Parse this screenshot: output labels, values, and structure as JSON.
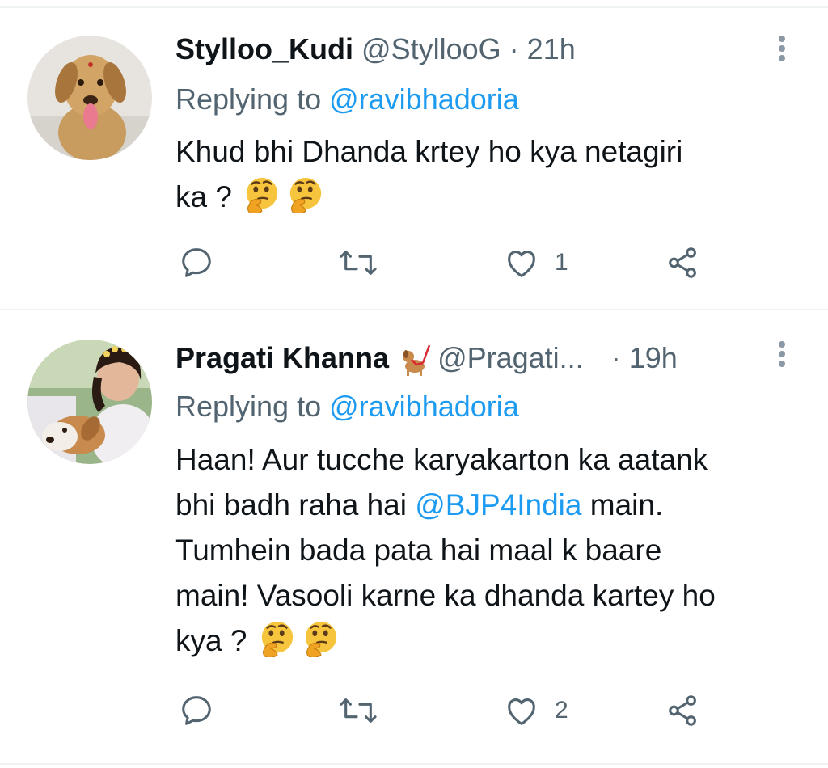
{
  "tweets": [
    {
      "display_name": "Stylloo_Kudi",
      "handle": "@StyllooG",
      "separator": "·",
      "time": "21h",
      "replying_prefix": "Replying to",
      "replying_handle": "@ravibhadoria",
      "text_parts": [
        "Khud bhi Dhanda krtey ho kya netagiri",
        "ka ?"
      ],
      "emojis": [
        "thinking-face",
        "thinking-face"
      ],
      "actions": {
        "reply_count": "",
        "retweet_count": "",
        "like_count": "1"
      }
    },
    {
      "display_name": "Pragati Khanna",
      "badge_icon": "dog-with-leash-emoji",
      "handle": "@Pragati...",
      "separator": "·",
      "time": "19h",
      "replying_prefix": "Replying to",
      "replying_handle": "@ravibhadoria",
      "text_parts": [
        "Haan! Aur tucche karyakarton ka aatank",
        "bhi badh raha hai",
        "@BJP4India",
        "main.",
        "Tumhein bada pata hai maal k baare",
        "main! Vasooli karne ka dhanda kartey ho",
        "kya ?"
      ],
      "emojis": [
        "thinking-face",
        "thinking-face"
      ],
      "actions": {
        "reply_count": "",
        "retweet_count": "",
        "like_count": "2"
      }
    }
  ],
  "icons": {
    "reply": "reply-icon",
    "retweet": "retweet-icon",
    "like": "heart-icon",
    "share": "share-icon",
    "more": "more-vertical-icon"
  },
  "colors": {
    "link": "#1d9bf0",
    "secondary": "#536471",
    "text": "#0f1419",
    "divider": "#eff3f4"
  }
}
